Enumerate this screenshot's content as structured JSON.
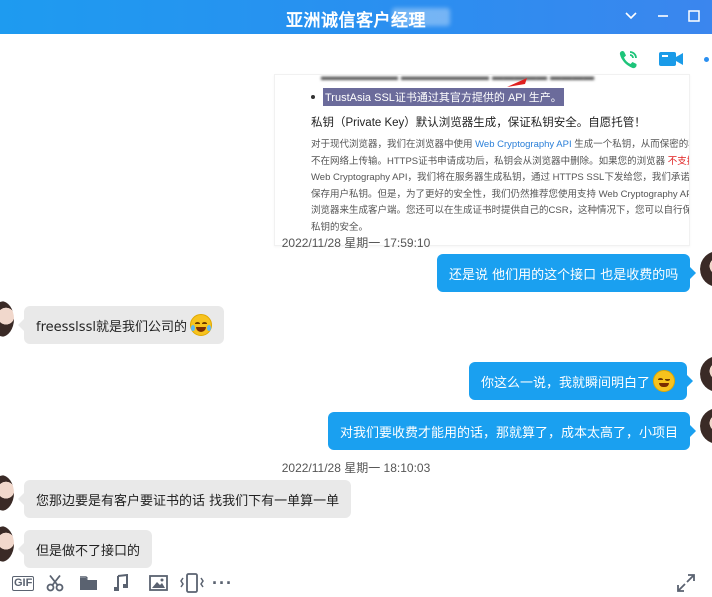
{
  "window": {
    "title": "亚洲诚信客户经理"
  },
  "shared_image": {
    "bullet_text": "TrustAsia SSL证书通过其官方提供的 API 生产。",
    "heading": "私钥（Private Key）默认浏览器生成，保证私钥安全。自愿托管！",
    "paragraph": {
      "part1": "对于现代浏览器，我们在浏览器中使用 ",
      "link1": "Web Cryptography API",
      "part2": " 生成一个私钥，从而保密的私钥不在网络上传输。HTTPS证书申请成功后，私钥会从浏览器中删除。如果您的浏览器 ",
      "red": "不支持",
      "part3": " Web Cryptography API，我们将在服务器生成私钥，通过 HTTPS SSL下发给您，我们承诺绝不保存用户私钥。但是，为了更好的安全性，我们仍然推荐您使用支持 Web Cryptography API 的浏览器来生成客户端。您还可以在生成证书时提供自己的CSR，这种情况下，您可以自行保证私钥的安全。"
    }
  },
  "messages": [
    {
      "type": "timestamp",
      "text": "2022/11/28 星期一 17:59:10"
    },
    {
      "type": "out",
      "text": "还是说 他们用的这个接口 也是收费的吗"
    },
    {
      "type": "in",
      "text": "freesslssl就是我们公司的",
      "emoji": "laughing-tears-emoji"
    },
    {
      "type": "out",
      "text": "你这么一说，我就瞬间明白了",
      "emoji": "wink-emoji"
    },
    {
      "type": "out",
      "text": "对我们要收费才能用的话，那就算了，成本太高了，小项目"
    },
    {
      "type": "timestamp",
      "text": "2022/11/28 星期一 18:10:03"
    },
    {
      "type": "in",
      "text": "您那边要是有客户要证书的话 找我们下有一单算一单"
    },
    {
      "type": "in",
      "text": "但是做不了接口的"
    }
  ],
  "toolbar": {
    "gif_label": "GIF",
    "more_label": "···"
  },
  "colors": {
    "accent": "#1aa0f0",
    "incoming_bubble": "#e9e9e9",
    "voice_call": "#1ec47a",
    "video_call": "#1a9be8"
  }
}
